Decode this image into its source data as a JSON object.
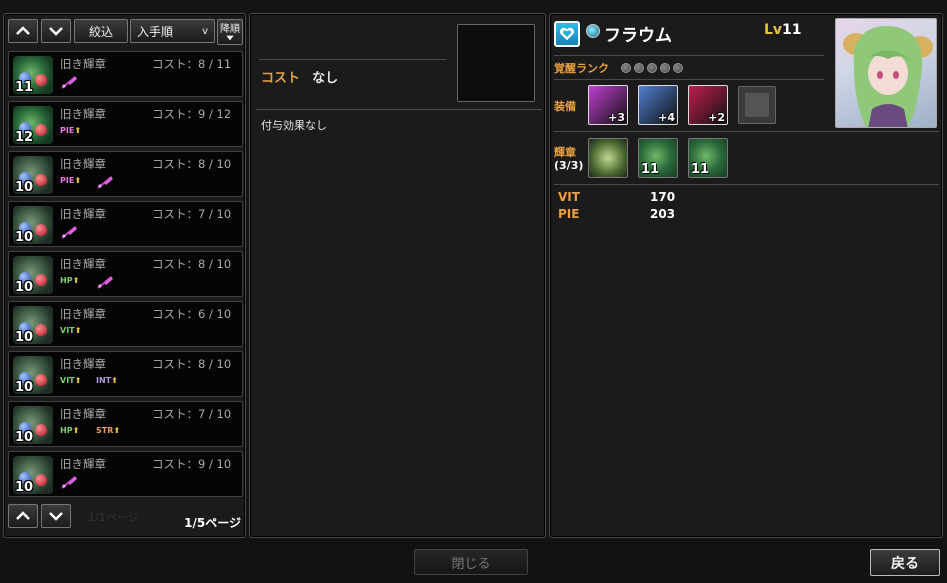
{
  "left_panel": {
    "filter_label": "絞込",
    "sort_select_value": "入手順",
    "sort_order_label": "降順",
    "page_indicator": "1/5ページ",
    "page_indicator_ghost": "1/1ページ",
    "items": [
      {
        "name": "旧き輝章",
        "cost": "コスト：8 / 11",
        "level": "11",
        "tags": [],
        "feather": true,
        "thumb": "green"
      },
      {
        "name": "旧き輝章",
        "cost": "コスト：9 / 12",
        "level": "12",
        "tags": [
          {
            "label": "PIE",
            "cls": "c-pie"
          }
        ],
        "feather": false,
        "thumb": "green"
      },
      {
        "name": "旧き輝章",
        "cost": "コスト：8 / 10",
        "level": "10",
        "tags": [
          {
            "label": "PIE",
            "cls": "c-pie"
          }
        ],
        "feather": true,
        "thumb": "gray"
      },
      {
        "name": "旧き輝章",
        "cost": "コスト：7 / 10",
        "level": "10",
        "tags": [],
        "feather": true,
        "thumb": "gray"
      },
      {
        "name": "旧き輝章",
        "cost": "コスト：8 / 10",
        "level": "10",
        "tags": [
          {
            "label": "HP",
            "cls": "c-hp"
          }
        ],
        "feather": true,
        "thumb": "gray"
      },
      {
        "name": "旧き輝章",
        "cost": "コスト：6 / 10",
        "level": "10",
        "tags": [
          {
            "label": "VIT",
            "cls": "c-vit"
          }
        ],
        "feather": false,
        "thumb": "gray"
      },
      {
        "name": "旧き輝章",
        "cost": "コスト：8 / 10",
        "level": "10",
        "tags": [
          {
            "label": "VIT",
            "cls": "c-vit"
          },
          {
            "label": "INT",
            "cls": "c-int"
          }
        ],
        "feather": false,
        "thumb": "gray"
      },
      {
        "name": "旧き輝章",
        "cost": "コスト：7 / 10",
        "level": "10",
        "tags": [
          {
            "label": "HP",
            "cls": "c-hp"
          },
          {
            "label": "STR",
            "cls": "c-str"
          }
        ],
        "feather": false,
        "thumb": "gray"
      },
      {
        "name": "旧き輝章",
        "cost": "コスト：9 / 10",
        "level": "10",
        "tags": [],
        "feather": true,
        "thumb": "gray"
      }
    ]
  },
  "middle_panel": {
    "cost_label": "コスト",
    "cost_value": "なし",
    "effect_text": "付与効果なし"
  },
  "right_panel": {
    "character_name": "フラウム",
    "level_prefix": "Lv",
    "level_value": "11",
    "awakening_label": "覚醒ランク",
    "awakening_rank": 0,
    "awakening_max": 5,
    "equipment_label": "装備",
    "equipment": [
      {
        "plus": "+3",
        "color": "#c040d0"
      },
      {
        "plus": "+4",
        "color": "#5080d0"
      },
      {
        "plus": "+2",
        "color": "#c02050"
      },
      {
        "plus": "",
        "color": "#555555"
      }
    ],
    "emblem_label": "輝章",
    "emblem_count": "(3/3)",
    "emblems": [
      {
        "level": ""
      },
      {
        "level": "11"
      },
      {
        "level": "11"
      }
    ],
    "stats": [
      {
        "name": "VIT",
        "value": "170"
      },
      {
        "name": "PIE",
        "value": "203"
      }
    ]
  },
  "footer": {
    "close_label": "閉じる",
    "back_label": "戻る"
  },
  "colors": {
    "accent_orange": "#e8a040",
    "level_gold": "#e8c040",
    "heart_icon": "#2bb0d8"
  }
}
